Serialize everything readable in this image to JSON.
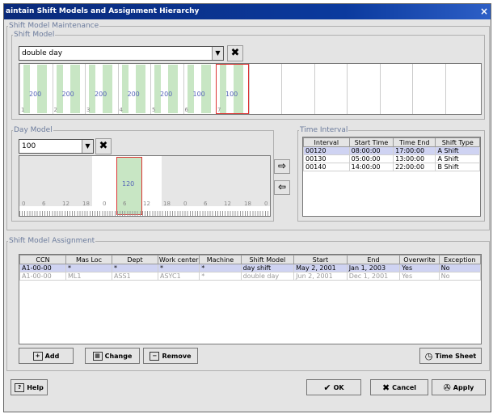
{
  "window": {
    "title": "aintain Shift Models and Assignment Hierarchy",
    "close": "×"
  },
  "maintenance": {
    "legend": "Shift Model Maintenance",
    "shift_model": {
      "legend": "Shift Model",
      "selected": "double day",
      "days": [
        {
          "num": "1",
          "value": "200"
        },
        {
          "num": "2",
          "value": "200"
        },
        {
          "num": "3",
          "value": "200"
        },
        {
          "num": "4",
          "value": "200"
        },
        {
          "num": "5",
          "value": "200"
        },
        {
          "num": "6",
          "value": "100"
        },
        {
          "num": "7",
          "value": "100"
        }
      ]
    },
    "day_model": {
      "legend": "Day Model",
      "selected": "100",
      "bar_value": "120",
      "ticks": [
        "0",
        "6",
        "12",
        "18",
        "0",
        "6",
        "12",
        "18",
        "0",
        "6",
        "12",
        "18",
        "0"
      ]
    },
    "time_interval": {
      "legend": "Time Interval",
      "columns": [
        "Interval",
        "Start Time",
        "Time End",
        "Shift Type"
      ],
      "rows": [
        [
          "00120",
          "08:00:00",
          "17:00:00",
          "A Shift"
        ],
        [
          "00130",
          "05:00:00",
          "13:00:00",
          "A Shift"
        ],
        [
          "00140",
          "14:00:00",
          "22:00:00",
          "B Shift"
        ]
      ]
    }
  },
  "assignment": {
    "legend": "Shift Model Assignment",
    "columns": [
      "CCN",
      "Mas Loc",
      "Dept",
      "Work center",
      "Machine",
      "Shift Model",
      "Start",
      "End",
      "Overwrite",
      "Exception"
    ],
    "rows": [
      [
        "A1-00-00",
        "*",
        "*",
        "*",
        "*",
        "day shift",
        "May 2, 2001",
        "Jan 1, 2003",
        "Yes",
        "No"
      ],
      [
        "A1-00-00",
        "ML1",
        "ASS1",
        "ASYC1",
        "*",
        "double day",
        "Jun 2, 2001",
        "Dec 1, 2001",
        "Yes",
        "No"
      ]
    ],
    "buttons": {
      "add": "Add",
      "change": "Change",
      "remove": "Remove",
      "time_sheet": "Time Sheet"
    }
  },
  "footer": {
    "help": "Help",
    "ok": "OK",
    "cancel": "Cancel",
    "apply": "Apply"
  }
}
